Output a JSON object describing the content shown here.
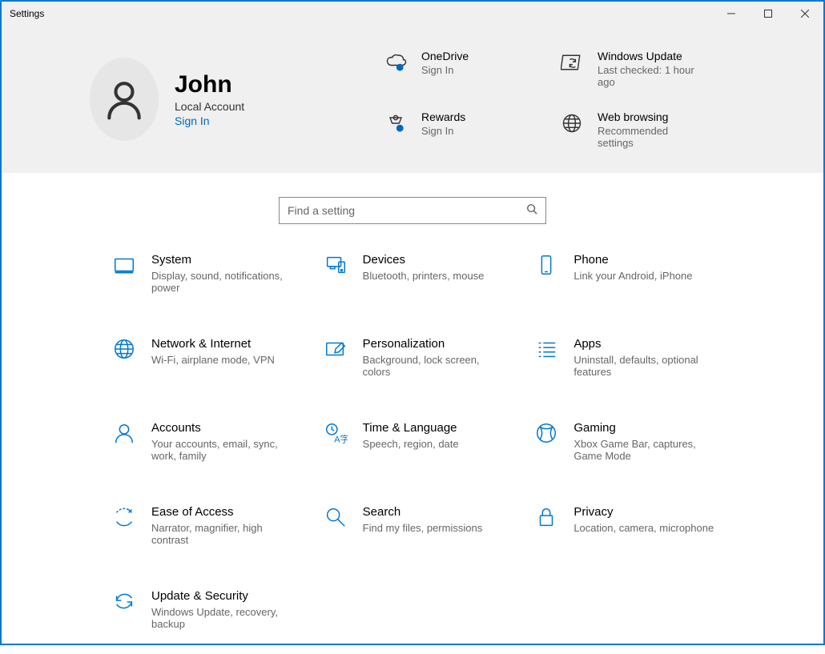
{
  "window": {
    "title": "Settings"
  },
  "user": {
    "name": "John",
    "account_type": "Local Account",
    "signin_label": "Sign In"
  },
  "header_tiles": {
    "onedrive": {
      "title": "OneDrive",
      "sub": "Sign In"
    },
    "windows_update": {
      "title": "Windows Update",
      "sub": "Last checked: 1 hour ago"
    },
    "rewards": {
      "title": "Rewards",
      "sub": "Sign In"
    },
    "web_browsing": {
      "title": "Web browsing",
      "sub": "Recommended settings"
    }
  },
  "search": {
    "placeholder": "Find a setting"
  },
  "categories": [
    {
      "id": "system",
      "title": "System",
      "sub": "Display, sound, notifications, power"
    },
    {
      "id": "devices",
      "title": "Devices",
      "sub": "Bluetooth, printers, mouse"
    },
    {
      "id": "phone",
      "title": "Phone",
      "sub": "Link your Android, iPhone"
    },
    {
      "id": "network",
      "title": "Network & Internet",
      "sub": "Wi-Fi, airplane mode, VPN"
    },
    {
      "id": "personalization",
      "title": "Personalization",
      "sub": "Background, lock screen, colors"
    },
    {
      "id": "apps",
      "title": "Apps",
      "sub": "Uninstall, defaults, optional features"
    },
    {
      "id": "accounts",
      "title": "Accounts",
      "sub": "Your accounts, email, sync, work, family"
    },
    {
      "id": "time",
      "title": "Time & Language",
      "sub": "Speech, region, date"
    },
    {
      "id": "gaming",
      "title": "Gaming",
      "sub": "Xbox Game Bar, captures, Game Mode"
    },
    {
      "id": "ease",
      "title": "Ease of Access",
      "sub": "Narrator, magnifier, high contrast"
    },
    {
      "id": "search",
      "title": "Search",
      "sub": "Find my files, permissions"
    },
    {
      "id": "privacy",
      "title": "Privacy",
      "sub": "Location, camera, microphone"
    },
    {
      "id": "update",
      "title": "Update & Security",
      "sub": "Windows Update, recovery, backup"
    }
  ]
}
